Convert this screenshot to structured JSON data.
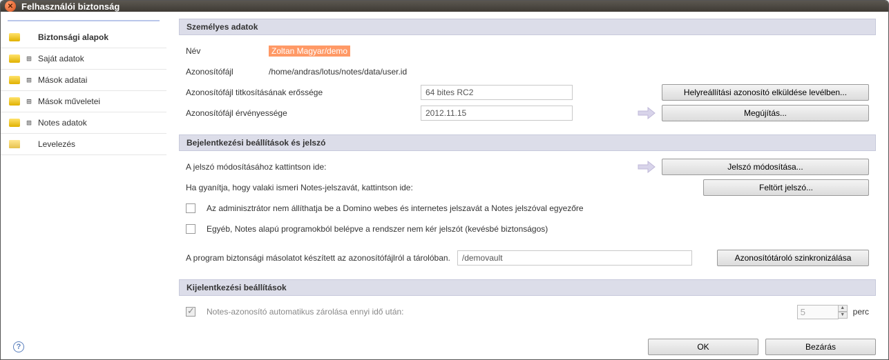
{
  "window": {
    "title": "Felhasználói biztonság"
  },
  "sidebar": {
    "items": [
      {
        "label": "Biztonsági alapok",
        "expandable": false,
        "active": true
      },
      {
        "label": "Saját adatok",
        "expandable": true
      },
      {
        "label": "Mások adatai",
        "expandable": true
      },
      {
        "label": "Mások műveletei",
        "expandable": true
      },
      {
        "label": "Notes adatok",
        "expandable": true
      },
      {
        "label": "Levelezés",
        "expandable": false
      }
    ]
  },
  "sections": {
    "personal": {
      "title": "Személyes adatok",
      "name_label": "Név",
      "name_value": "Zoltan Magyar/demo",
      "idfile_label": "Azonosítófájl",
      "idfile_value": "/home/andras/lotus/notes/data/user.id",
      "enc_label": "Azonosítófájl titkosításának erőssége",
      "enc_value": "64 bites RC2",
      "recovery_btn": "Helyreállítási azonosító elküldése levélben...",
      "exp_label": "Azonosítófájl érvényessége",
      "exp_value": "2012.11.15",
      "renew_btn": "Megújítás..."
    },
    "login": {
      "title": "Bejelentkezési beállítások és jelszó",
      "change_pw_hint": "A jelszó módosításához kattintson ide:",
      "change_pw_btn": "Jelszó módosítása...",
      "compromised_hint": "Ha gyanítja, hogy valaki ismeri Notes-jelszavát, kattintson ide:",
      "compromised_btn": "Feltört jelszó...",
      "chk1": "Az adminisztrátor nem állíthatja be a Domino webes és internetes jelszavát a Notes jelszóval egyezőre",
      "chk2": "Egyéb, Notes alapú programokból belépve a rendszer nem kér jelszót (kevésbé biztonságos)",
      "vault_hint": "A program biztonsági másolatot készített az azonosítófájlról a tárolóban.",
      "vault_value": "/demovault",
      "vault_btn": "Azonosítótároló szinkronizálása"
    },
    "logout": {
      "title": "Kijelentkezési beállítások",
      "autolock_label": "Notes-azonosító automatikus zárolása ennyi idő után:",
      "autolock_value": "5",
      "autolock_unit": "perc"
    }
  },
  "footer": {
    "ok": "OK",
    "close": "Bezárás"
  }
}
